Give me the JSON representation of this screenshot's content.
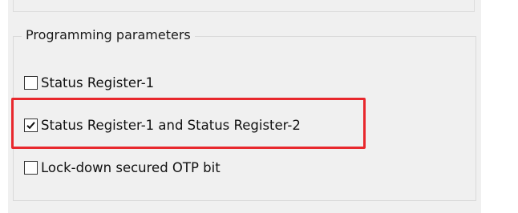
{
  "group": {
    "title": "Programming parameters"
  },
  "options": [
    {
      "label": "Status Register-1",
      "checked": false
    },
    {
      "label": "Status Register-1 and Status Register-2",
      "checked": true
    },
    {
      "label": "Lock-down secured OTP bit",
      "checked": false
    }
  ],
  "colors": {
    "highlight": "#e8282d",
    "window_bg": "#f0f0f0"
  }
}
